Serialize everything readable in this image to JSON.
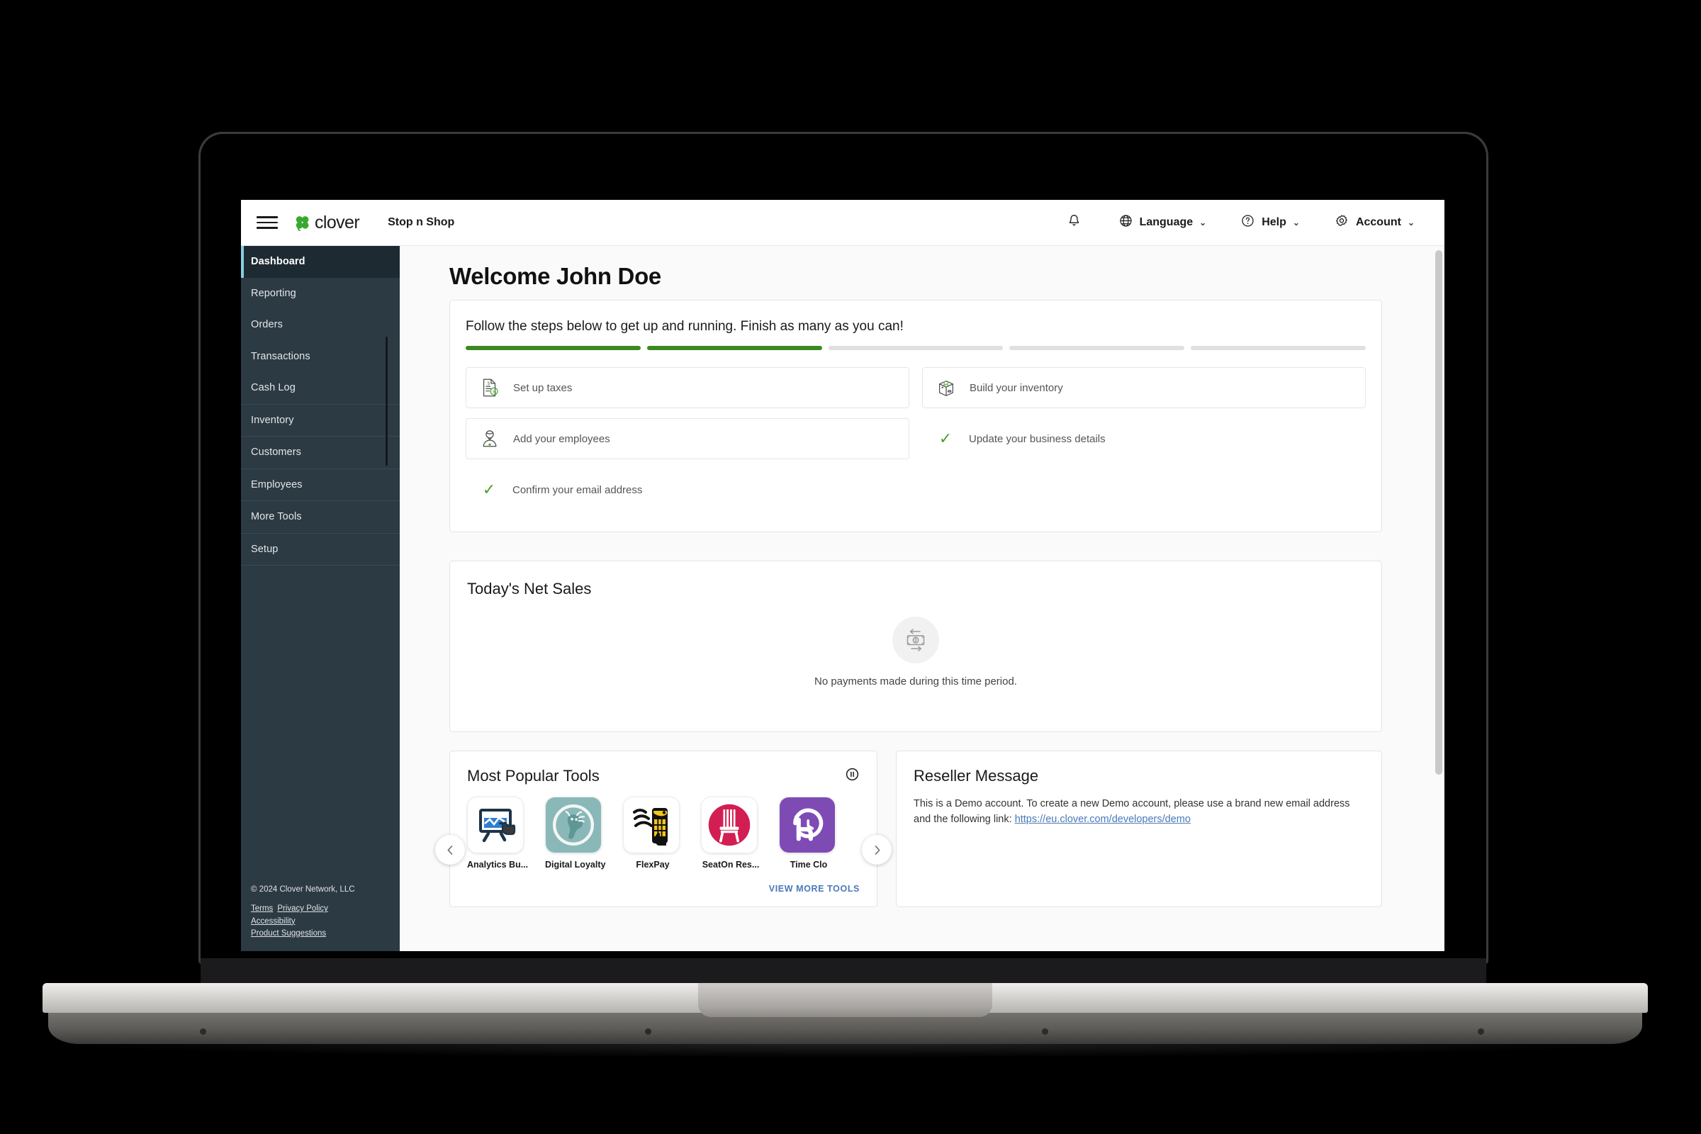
{
  "topbar": {
    "menu_icon": "hamburger-icon",
    "brand": "clover",
    "merchant": "Stop n Shop",
    "notifications_icon": "bell-icon",
    "items": [
      {
        "label": "Language",
        "icon": "globe-icon",
        "caret": "⌄"
      },
      {
        "label": "Help",
        "icon": "question-circle-icon",
        "caret": "⌄"
      },
      {
        "label": "Account",
        "icon": "gear-icon",
        "caret": "⌄"
      }
    ]
  },
  "sidebar": {
    "groups": [
      {
        "items": [
          {
            "label": "Dashboard",
            "active": true
          },
          {
            "label": "Reporting",
            "active": false
          },
          {
            "label": "Orders",
            "active": false
          },
          {
            "label": "Transactions",
            "active": false
          },
          {
            "label": "Cash Log",
            "active": false
          }
        ]
      },
      {
        "items": [
          {
            "label": "Inventory",
            "active": false
          }
        ]
      },
      {
        "items": [
          {
            "label": "Customers",
            "active": false
          }
        ]
      },
      {
        "items": [
          {
            "label": "Employees",
            "active": false
          }
        ]
      },
      {
        "items": [
          {
            "label": "More Tools",
            "active": false
          }
        ]
      },
      {
        "items": [
          {
            "label": "Setup",
            "active": false
          }
        ]
      }
    ],
    "footer": {
      "copyright": "© 2024 Clover Network, LLC",
      "links": [
        "Terms",
        "Privacy Policy",
        "Accessibility",
        "Product Suggestions"
      ]
    }
  },
  "main": {
    "page_title": "Welcome John Doe",
    "setup": {
      "subtitle": "Follow the steps below to get up and running. Finish as many as you can!",
      "progress_total": 5,
      "progress_done": 2,
      "tasks_left": [
        {
          "label": "Set up taxes",
          "state": "todo",
          "icon": "tax-document-icon"
        },
        {
          "label": "Add your employees",
          "state": "todo",
          "icon": "employee-icon"
        },
        {
          "label": "Confirm your email address",
          "state": "done",
          "icon": "check-icon"
        }
      ],
      "tasks_right": [
        {
          "label": "Build your inventory",
          "state": "todo",
          "icon": "box-icon"
        },
        {
          "label": "Update your business details",
          "state": "done",
          "icon": "check-icon"
        }
      ]
    },
    "net_sales": {
      "title": "Today's Net Sales",
      "empty_icon": "money-transfer-icon",
      "empty_text": "No payments made during this time period."
    },
    "tools": {
      "title": "Most Popular Tools",
      "pause_icon": "pause-circle-icon",
      "prev_icon": "chevron-left-icon",
      "next_icon": "chevron-right-icon",
      "view_more": "VIEW MORE TOOLS",
      "apps": [
        {
          "label": "Analytics Bu...",
          "icon": "analytics-board-icon"
        },
        {
          "label": "Digital Loyalty",
          "icon": "giraffe-icon"
        },
        {
          "label": "FlexPay",
          "icon": "cordless-phone-icon"
        },
        {
          "label": "SeatOn Res...",
          "icon": "chair-icon"
        },
        {
          "label": "Time Clo",
          "icon": "clock-hand-icon"
        }
      ]
    },
    "reseller": {
      "title": "Reseller Message",
      "body": "This is a Demo account. To create a new Demo account, please use a brand new email address and the following link:",
      "link": "https://eu.clover.com/developers/demo"
    }
  },
  "colors": {
    "sidebar_bg": "#2c3a43",
    "sidebar_active": "#1e2a31",
    "accent_blue": "#84cfe8",
    "progress_green": "#3b8a20",
    "check_green": "#49a22b",
    "link_blue": "#4a79b8",
    "brand_green": "#38a832"
  }
}
